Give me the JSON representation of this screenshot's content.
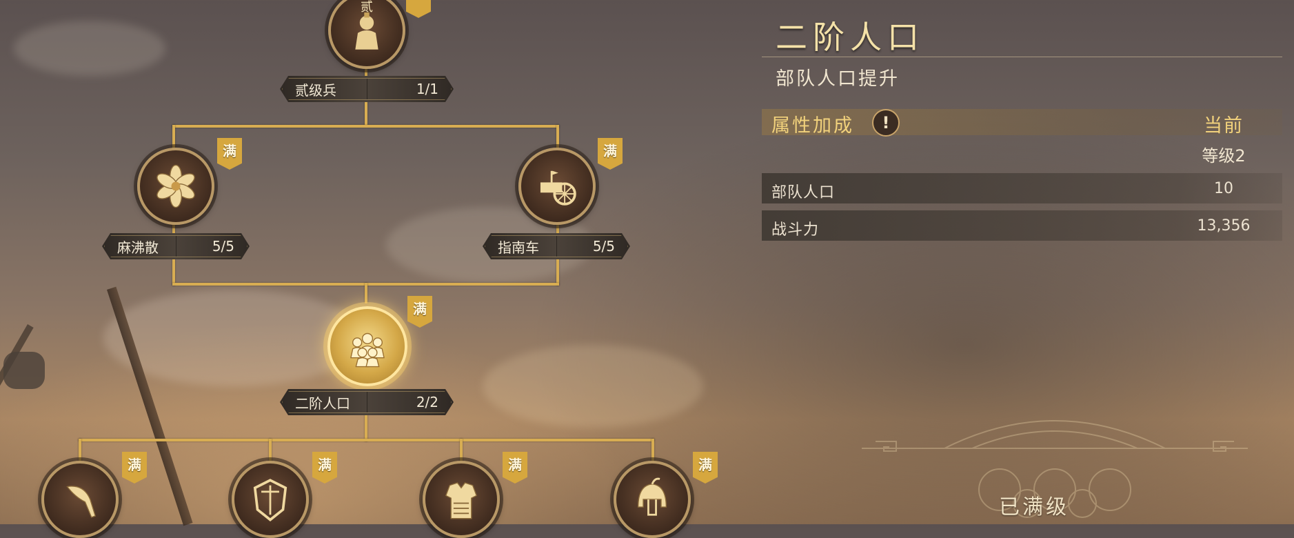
{
  "tree": {
    "root": {
      "name": "贰级兵",
      "progress": "1/1",
      "node_label": "贰"
    },
    "level2": [
      {
        "name": "麻沸散",
        "progress": "5/5",
        "badge": "满",
        "icon": "lotus-flower-icon"
      },
      {
        "name": "指南车",
        "progress": "5/5",
        "badge": "满",
        "icon": "chariot-icon"
      }
    ],
    "selected": {
      "name": "二阶人口",
      "progress": "2/2",
      "badge": "满",
      "icon": "soldier-group-icon"
    },
    "children": [
      {
        "badge": "满",
        "icon": "quill-brush-icon"
      },
      {
        "badge": "满",
        "icon": "shield-icon"
      },
      {
        "badge": "满",
        "icon": "armor-icon"
      },
      {
        "badge": "满",
        "icon": "helmet-icon"
      }
    ]
  },
  "detail": {
    "title": "二阶人口",
    "subtitle": "部队人口提升",
    "attr_label": "属性加成",
    "info_glyph": "!",
    "column_header": "当前",
    "level": "等级2",
    "rows": [
      {
        "label": "部队人口",
        "value": "10"
      },
      {
        "label": "战斗力",
        "value": "13,356"
      }
    ],
    "status": "已满级"
  },
  "colors": {
    "accent_gold": "#d8ad52",
    "badge": "#d6a73e",
    "title": "#f4e1a8"
  }
}
